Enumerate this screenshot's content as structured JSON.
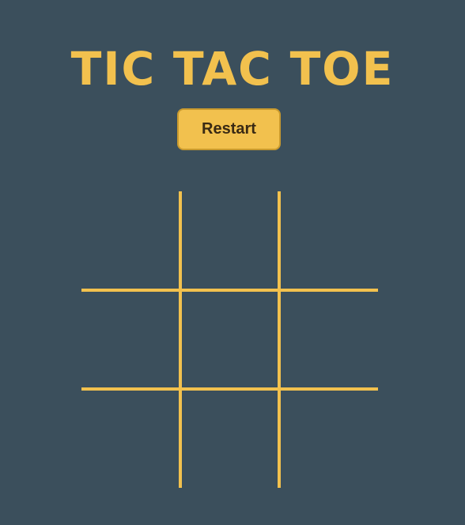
{
  "game": {
    "title": "TIC TAC TOE",
    "restart_label": "Restart",
    "board": [
      "",
      "",
      "",
      "",
      "",
      "",
      "",
      "",
      ""
    ]
  },
  "colors": {
    "background": "#3b4f5c",
    "accent": "#f2c14e",
    "button_text": "#3a2a14"
  }
}
